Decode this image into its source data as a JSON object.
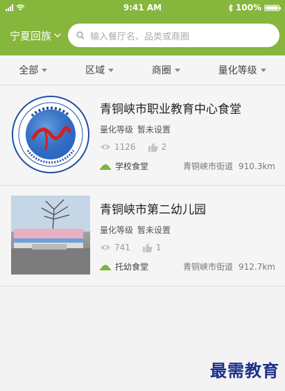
{
  "status_bar": {
    "time": "9:41 AM",
    "battery": "100%",
    "battery_level": 1.0
  },
  "header": {
    "city": "宁夏回族",
    "search_placeholder": "输入餐厅名、品类或商圈"
  },
  "filters": [
    {
      "label": "全部"
    },
    {
      "label": "区域"
    },
    {
      "label": "商圈"
    },
    {
      "label": "量化等级"
    }
  ],
  "restaurants": [
    {
      "name": "青铜峡市职业教育中心食堂",
      "level_label": "量化等级",
      "level_value": "暂未设置",
      "views": "1126",
      "likes": "2",
      "type": "学校食堂",
      "address": "青铜峡市街道",
      "distance": "910.3km"
    },
    {
      "name": "青铜峡市第二幼儿园",
      "level_label": "量化等级",
      "level_value": "暂未设置",
      "views": "741",
      "likes": "1",
      "type": "托幼食堂",
      "address": "青铜峡市街道",
      "distance": "912.7km"
    }
  ],
  "watermark": "最需教育",
  "colors": {
    "brand_green": "#86b63c",
    "type_icon_green": "#7cb342"
  }
}
